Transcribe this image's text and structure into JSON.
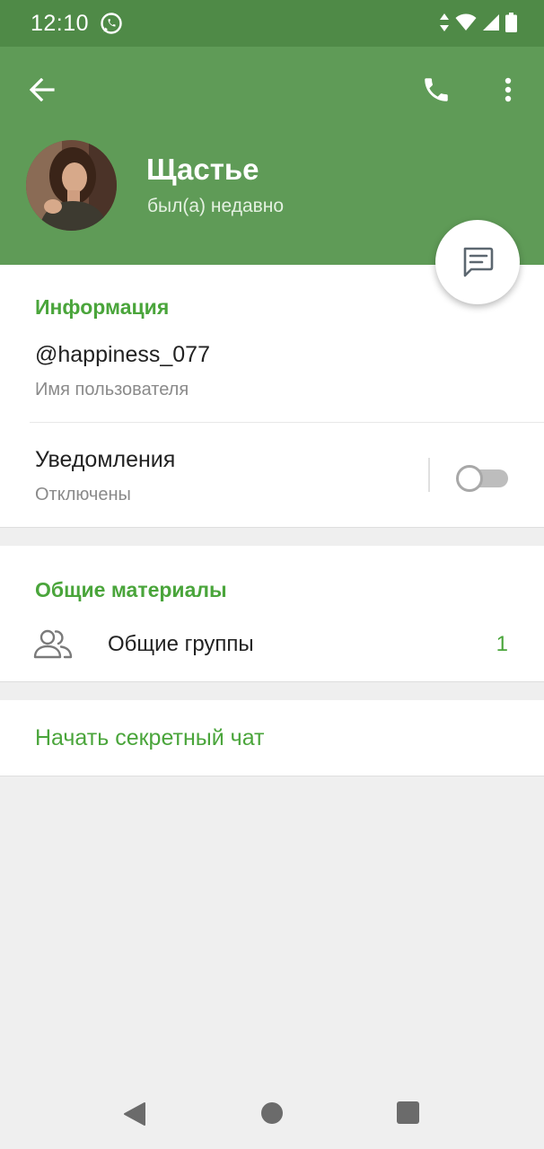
{
  "status_bar": {
    "time": "12:10",
    "notification_icon": "whatsapp-icon",
    "icons": [
      "data-arrows-icon",
      "wifi-icon",
      "cellular-signal-icon",
      "battery-icon"
    ]
  },
  "header": {
    "back_icon": "arrow-back-icon",
    "call_icon": "phone-icon",
    "menu_icon": "more-vertical-icon",
    "name": "Щастье",
    "status": "был(а) недавно",
    "colors": {
      "status_bar": "#4f8a47",
      "header": "#5f9b57",
      "accent": "#4aa53b"
    }
  },
  "fab": {
    "icon": "message-icon"
  },
  "info": {
    "title": "Информация",
    "username": "@happiness_077",
    "username_label": "Имя пользователя",
    "notifications_label": "Уведомления",
    "notifications_state": "Отключены",
    "notifications_on": false
  },
  "shared": {
    "title": "Общие материалы",
    "groups_icon": "group-icon",
    "groups_label": "Общие группы",
    "groups_count": "1"
  },
  "secret": {
    "label": "Начать секретный чат"
  },
  "navbar": {
    "back_icon": "nav-back-icon",
    "home_icon": "nav-home-icon",
    "recents_icon": "nav-recents-icon"
  }
}
